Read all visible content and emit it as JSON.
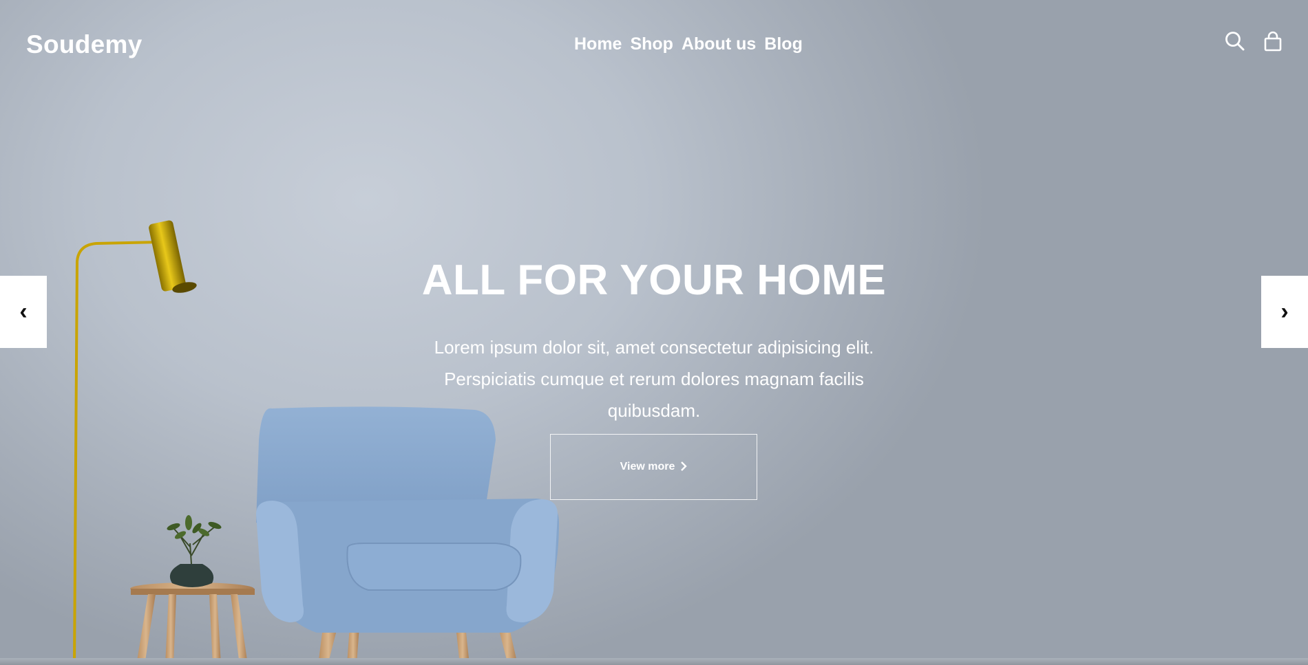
{
  "header": {
    "logo": "Soudemy",
    "nav": [
      "Home",
      "Shop",
      "About us",
      "Blog"
    ],
    "icons": [
      "search-icon",
      "shopping-bag-icon"
    ]
  },
  "hero": {
    "title": "ALL FOR YOUR HOME",
    "description": "Lorem ipsum dolor sit, amet consectetur adipisicing elit. Perspiciatis cumque et rerum dolores magnam facilis quibusdam.",
    "button_label": "View more",
    "button_icon": "chevron-right-icon"
  },
  "slider": {
    "prev_glyph": "‹",
    "next_glyph": "›"
  },
  "colors": {
    "background": "#b9c1cc",
    "text": "#ffffff",
    "chair": "#8fb0d6",
    "lamp": "#c9a800",
    "table": "#c9a37a"
  }
}
